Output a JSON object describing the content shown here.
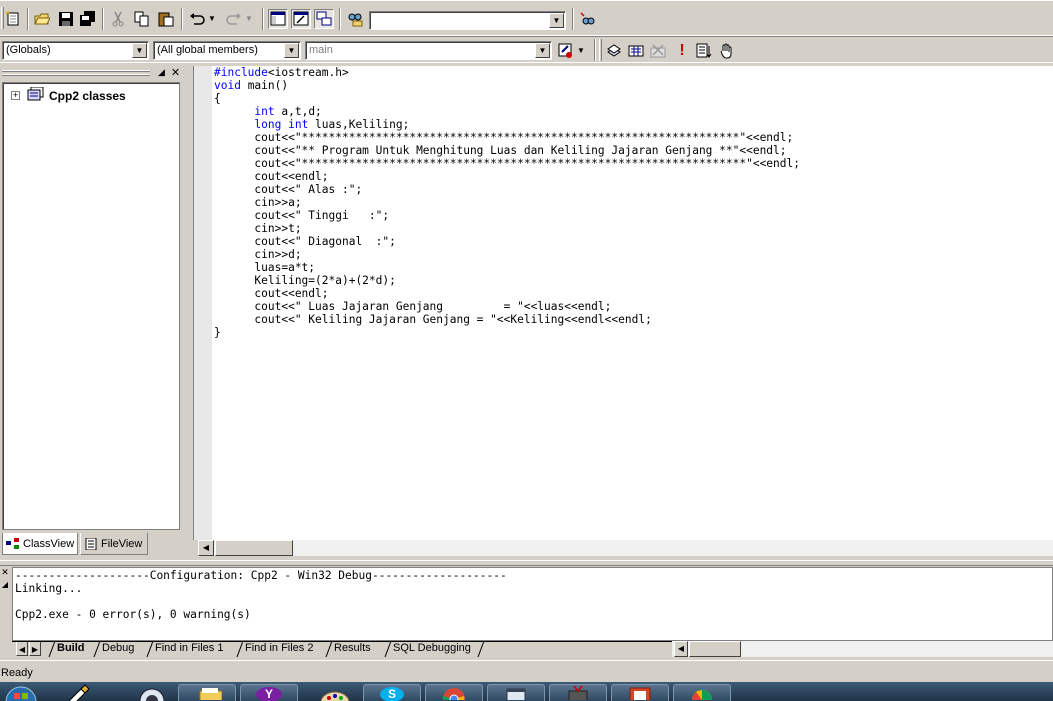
{
  "toolbar1": {
    "find_combo_value": "",
    "icons": [
      "new-file-icon",
      "open-folder-icon",
      "save-icon",
      "save-all-icon",
      "cut-icon",
      "copy-icon",
      "paste-icon",
      "undo-icon",
      "redo-icon",
      "workspace-icon",
      "output-icon",
      "window-list-icon",
      "find-in-files-icon",
      "find-icon"
    ]
  },
  "toolbar2": {
    "scope_combo": "(Globals)",
    "members_combo": "(All global members)",
    "function_combo": "main",
    "icons": [
      "wizard-action-icon",
      "compile-icon",
      "build-icon",
      "stop-build-icon",
      "execute-icon",
      "insert-breakpoint-icon",
      "go-icon"
    ]
  },
  "workspace": {
    "tree_root": "Cpp2 classes",
    "tabs": [
      "ClassView",
      "FileView"
    ]
  },
  "editor": {
    "lines": [
      [
        {
          "t": "#include",
          "k": 1
        },
        {
          "t": "<iostream.h>",
          "k": 0
        }
      ],
      [
        {
          "t": "void",
          "k": 1
        },
        {
          "t": " main()",
          "k": 0
        }
      ],
      [
        {
          "t": "{",
          "k": 0
        }
      ],
      [
        {
          "t": "      ",
          "k": 0
        },
        {
          "t": "int",
          "k": 1
        },
        {
          "t": " a,t,d;",
          "k": 0
        }
      ],
      [
        {
          "t": "      ",
          "k": 0
        },
        {
          "t": "long int",
          "k": 1
        },
        {
          "t": " luas,Keliling;",
          "k": 0
        }
      ],
      [
        {
          "t": "      cout<<\"*****************************************************************\"<<endl;",
          "k": 0
        }
      ],
      [
        {
          "t": "      cout<<\"** Program Untuk Menghitung Luas dan Keliling Jajaran Genjang **\"<<endl;",
          "k": 0
        }
      ],
      [
        {
          "t": "      cout<<\"******************************************************************\"<<endl;",
          "k": 0
        }
      ],
      [
        {
          "t": "      cout<<endl;",
          "k": 0
        }
      ],
      [
        {
          "t": "      cout<<\" Alas :\";",
          "k": 0
        }
      ],
      [
        {
          "t": "      cin>>a;",
          "k": 0
        }
      ],
      [
        {
          "t": "      cout<<\" Tinggi   :\";",
          "k": 0
        }
      ],
      [
        {
          "t": "      cin>>t;",
          "k": 0
        }
      ],
      [
        {
          "t": "      cout<<\" Diagonal  :\";",
          "k": 0
        }
      ],
      [
        {
          "t": "      cin>>d;",
          "k": 0
        }
      ],
      [
        {
          "t": "      luas=a*t;",
          "k": 0
        }
      ],
      [
        {
          "t": "      Keliling=(2*a)+(2*d);",
          "k": 0
        }
      ],
      [
        {
          "t": "      cout<<endl;",
          "k": 0
        }
      ],
      [
        {
          "t": "      cout<<\" Luas Jajaran Genjang         = \"<<luas<<endl;",
          "k": 0
        }
      ],
      [
        {
          "t": "      cout<<\" Keliling Jajaran Genjang = \"<<Keliling<<endl<<endl;",
          "k": 0
        }
      ],
      [
        {
          "t": "}",
          "k": 0
        }
      ]
    ]
  },
  "output": {
    "lines": [
      "--------------------Configuration: Cpp2 - Win32 Debug--------------------",
      "Linking...",
      "",
      "Cpp2.exe - 0 error(s), 0 warning(s)"
    ],
    "tabs": [
      "Build",
      "Debug",
      "Find in Files 1",
      "Find in Files 2",
      "Results",
      "SQL Debugging"
    ],
    "active_tab": "Build"
  },
  "status": {
    "text": "Ready"
  },
  "taskbar": {
    "items": [
      "start-orb-icon",
      "paint-app-icon",
      "media-icon",
      "explorer-folder-icon",
      "yahoo-messenger-icon",
      "paint-palette-icon",
      "skype-icon",
      "chrome-icon",
      "window-app-icon",
      "tv-app-icon",
      "powerpoint-icon",
      "chart-app-icon"
    ],
    "colors": {
      "bar": "#2a4157",
      "yahoo": "#7b1fa2",
      "skype": "#00aff0",
      "chrome": "#db4437",
      "powerpoint": "#d24726"
    }
  },
  "colors": {
    "keyword": "#0000ff",
    "chrome": "#d4d0c8"
  }
}
